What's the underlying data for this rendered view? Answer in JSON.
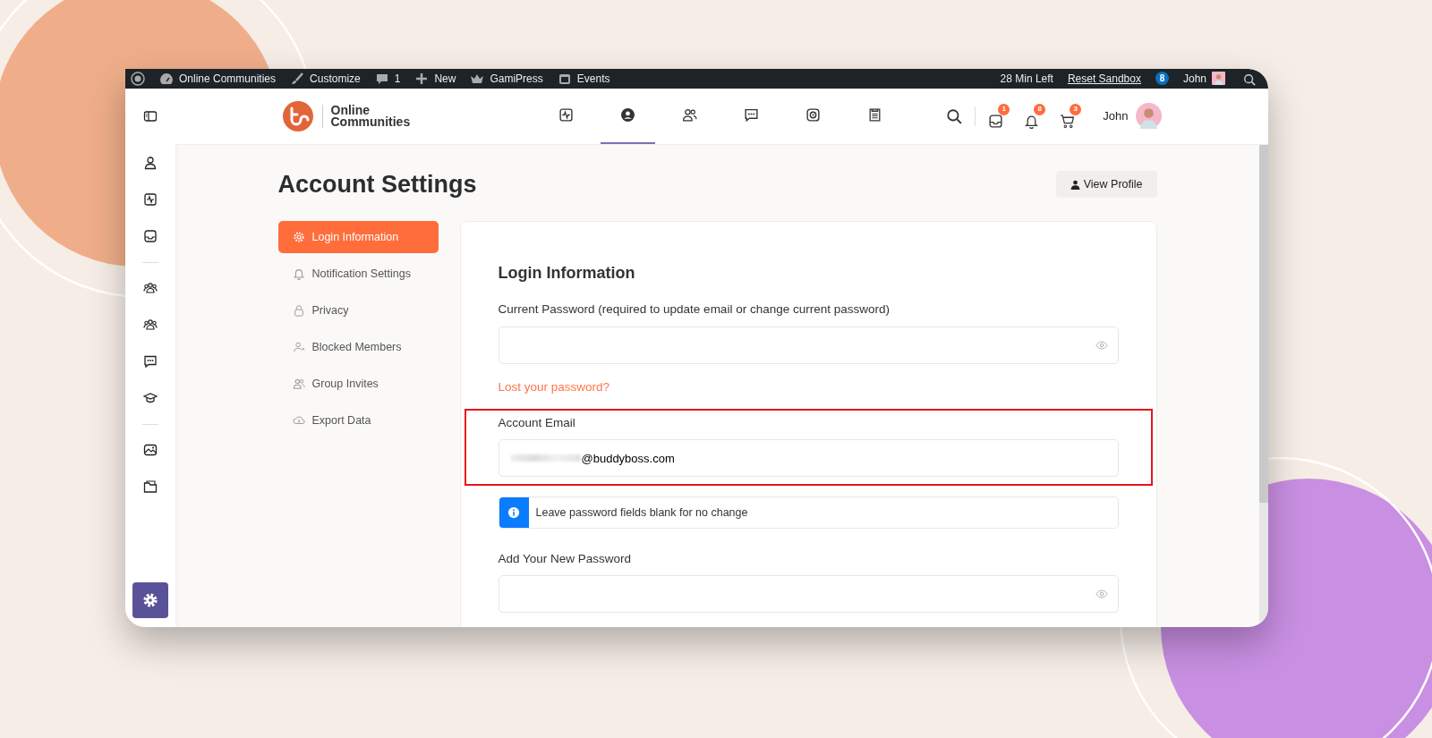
{
  "admin_bar": {
    "left": [
      {
        "kind": "wordpress"
      },
      {
        "kind": "gauge",
        "label": "Online Communities"
      },
      {
        "kind": "brush",
        "label": "Customize"
      },
      {
        "kind": "comment",
        "label": "1"
      },
      {
        "kind": "plus",
        "label": "New"
      },
      {
        "kind": "crown",
        "label": "GamiPress"
      },
      {
        "kind": "calendar",
        "label": "Events"
      }
    ],
    "timer": "28 Min Left",
    "reset_link": "Reset Sandbox",
    "badge": "8",
    "user": "John"
  },
  "header": {
    "logo_lines": [
      "Online",
      "Communities"
    ],
    "nav": [
      {
        "kind": "activity",
        "selected": false
      },
      {
        "kind": "profile",
        "selected": true
      },
      {
        "kind": "people",
        "selected": false
      },
      {
        "kind": "chat",
        "selected": false
      },
      {
        "kind": "media",
        "selected": false
      },
      {
        "kind": "document",
        "selected": false
      }
    ],
    "actions": [
      {
        "kind": "inbox",
        "count": "1"
      },
      {
        "kind": "bell",
        "count": "8"
      },
      {
        "kind": "cart",
        "count": "3"
      }
    ],
    "user": "John"
  },
  "rail": [
    {
      "kind": "toggle"
    },
    {
      "kind": "person"
    },
    {
      "kind": "activity"
    },
    {
      "kind": "inbox"
    },
    {
      "kind": "divider"
    },
    {
      "kind": "group"
    },
    {
      "kind": "group"
    },
    {
      "kind": "chat"
    },
    {
      "kind": "cap"
    },
    {
      "kind": "divider"
    },
    {
      "kind": "photo"
    },
    {
      "kind": "folder"
    }
  ],
  "page": {
    "title": "Account Settings",
    "view_profile": "View Profile",
    "menu": [
      {
        "kind": "gear",
        "label": "Login Information",
        "selected": true
      },
      {
        "kind": "bell",
        "label": "Notification Settings",
        "selected": false
      },
      {
        "kind": "lock",
        "label": "Privacy",
        "selected": false
      },
      {
        "kind": "blocked",
        "label": "Blocked Members",
        "selected": false
      },
      {
        "kind": "people",
        "label": "Group Invites",
        "selected": false
      },
      {
        "kind": "cloud",
        "label": "Export Data",
        "selected": false
      }
    ],
    "card": {
      "heading": "Login Information",
      "items": [
        {
          "kind": "password",
          "label": "Current Password (required to update email or change current password)",
          "highlighted": false
        },
        {
          "kind": "link",
          "label": "Lost your password?"
        },
        {
          "kind": "email",
          "label": "Account Email",
          "value": "@buddyboss.com",
          "redacted": true,
          "highlighted": true
        },
        {
          "kind": "notice",
          "label": "Leave password fields blank for no change"
        },
        {
          "kind": "password",
          "label": "Add Your New Password",
          "highlighted": false
        }
      ]
    }
  }
}
